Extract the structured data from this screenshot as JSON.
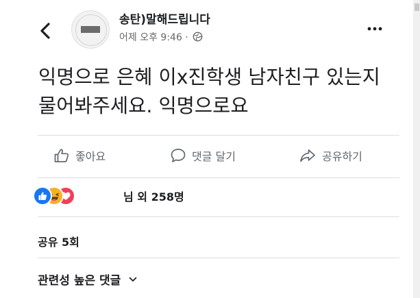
{
  "header": {
    "page_name": "송탄)말해드립니다",
    "timestamp": "어제 오후 9:46 ·",
    "avatar_icon": "page-avatar",
    "back_icon": "chevron-left-icon",
    "privacy_icon": "globe-icon",
    "more_icon": "more-dots-icon"
  },
  "post": {
    "text": "익명으로 은혜 이x진학생 남자친구 있는지 물어봐주세요. 익명으로요"
  },
  "actions": {
    "like_label": "좋아요",
    "comment_label": "댓글 달기",
    "share_label": "공유하기"
  },
  "reactions": {
    "types": [
      "like",
      "haha",
      "love"
    ],
    "count_text": "님 외 258명",
    "colors": {
      "like": "#1877f2",
      "haha": "#f7b125",
      "love": "#f33e58"
    }
  },
  "shares": {
    "text": "공유 5회"
  },
  "comments": {
    "sort_label": "관련성 높은 댓글",
    "sort_icon": "chevron-down-icon"
  }
}
